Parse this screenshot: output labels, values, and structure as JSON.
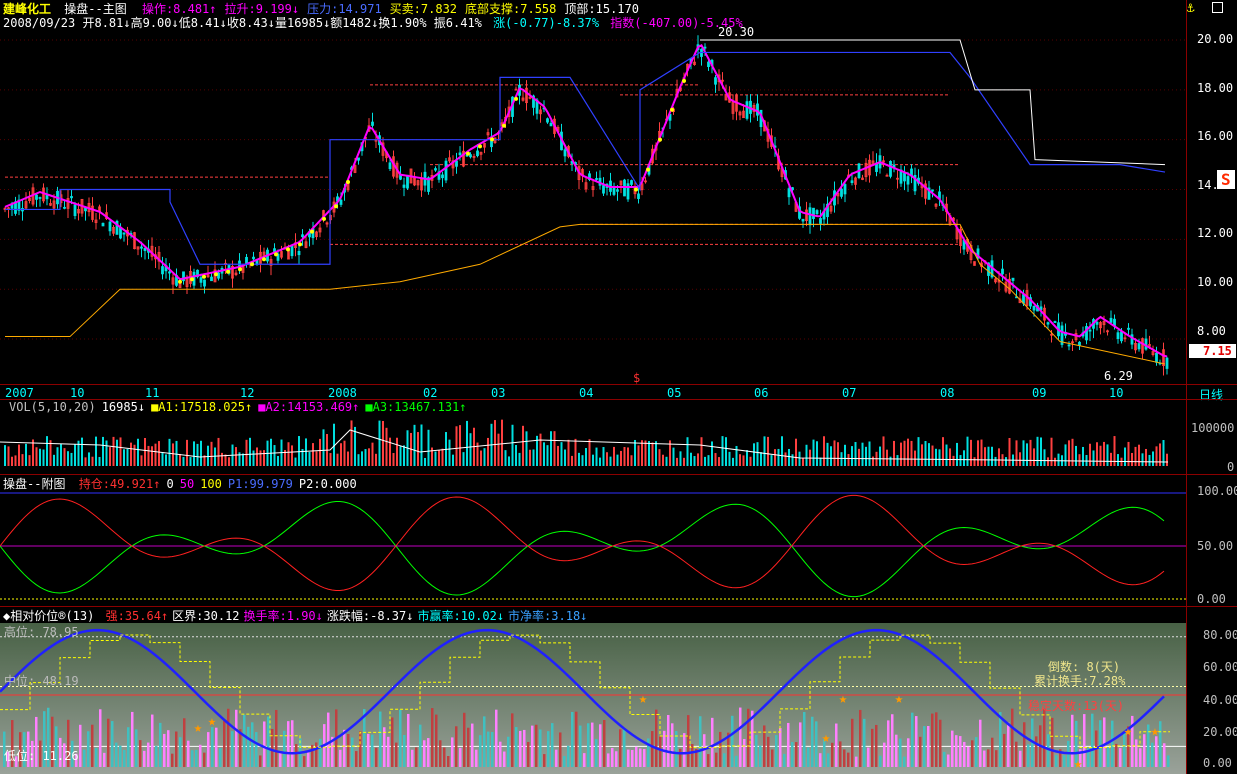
{
  "header": {
    "stock_name": "建峰化工",
    "main_title": "操盘--主图",
    "indicators": [
      {
        "label": "操作:8.481",
        "arrow": "↑",
        "color": "#ff00ff"
      },
      {
        "label": "拉升:9.199",
        "arrow": "↓",
        "color": "#ff00ff"
      },
      {
        "label": "压力:14.971",
        "arrow": "",
        "color": "#4a6cff"
      },
      {
        "label": "买卖:7.832",
        "arrow": "",
        "color": "#ffff00"
      },
      {
        "label": "底部支撑:7.558",
        "arrow": "",
        "color": "#ffff00"
      },
      {
        "label": "顶部:15.170",
        "arrow": "",
        "color": "#ffffff"
      }
    ],
    "quote_line": "2008/09/23  开8.81↓高9.00↓低8.41↓收8.43↓量16985↓额1482↓换1.90%  振6.41%",
    "change_text": "涨(-0.77)-8.37%",
    "index_text": "指数(-407.00)-5.45%",
    "corner_icon": "anchor-icon"
  },
  "main_chart": {
    "high_marker": "20.30",
    "low_marker": "6.29",
    "current_price": "7.15",
    "y_ticks": [
      "20.00",
      "18.00",
      "16.00",
      "14.00",
      "12.00",
      "10.00",
      "8.00"
    ],
    "period": "日线",
    "logo_text": "S"
  },
  "time_axis": {
    "labels": [
      "2007",
      "10",
      "11",
      "12",
      "2008",
      "02",
      "03",
      "04",
      "05",
      "06",
      "07",
      "08",
      "09",
      "10"
    ],
    "marker": "$"
  },
  "volume": {
    "header": [
      {
        "text": "VOL(5,10,20)",
        "color": "#c0c0c0"
      },
      {
        "text": "16985↓",
        "color": "#ffffff"
      },
      {
        "text": "■A1:17518.025↑",
        "color": "#ffff00"
      },
      {
        "text": "■A2:14153.469↑",
        "color": "#ff00ff"
      },
      {
        "text": "■A3:13467.131↑",
        "color": "#00ff00"
      }
    ],
    "y_ticks": [
      "100000",
      "0"
    ]
  },
  "sub1": {
    "title": "操盘--附图",
    "items": [
      {
        "text": "持仓:49.921↑",
        "color": "#ff3030"
      },
      {
        "text": "0",
        "color": "#ffffff"
      },
      {
        "text": "50",
        "color": "#ff00ff"
      },
      {
        "text": "100",
        "color": "#ffff00"
      },
      {
        "text": "P1:99.979",
        "color": "#4a6cff"
      },
      {
        "text": "P2:0.000",
        "color": "#ffffff"
      }
    ],
    "y_ticks": [
      "100.00",
      "50.00",
      "0.00"
    ]
  },
  "sub2": {
    "title": "◆相对价位®(13)",
    "items": [
      {
        "text": "强:35.64↑",
        "color": "#ff3030"
      },
      {
        "text": "区界:30.12",
        "color": "#ffffff"
      },
      {
        "text": "换手率:1.90↓",
        "color": "#ff00ff"
      },
      {
        "text": "涨跌幅:-8.37↓",
        "color": "#ffffff"
      },
      {
        "text": "市赢率:10.02↓",
        "color": "#00ffff"
      },
      {
        "text": "市净率:3.18↓",
        "color": "#3aa0ff"
      }
    ],
    "high_label": "高位: 78.95",
    "mid_label": "中位: 48.19",
    "low_label": "低位: 11.26",
    "countdown": "倒数: 8(天)",
    "cumulative": "累计换手:7.28%",
    "stable_days": "稳定天数:13(天)",
    "y_ticks": [
      "80.00",
      "60.00",
      "40.00",
      "20.00",
      "0.00"
    ]
  },
  "colors": {
    "up": "#ff4040",
    "down": "#00e0e0",
    "panel_border": "#8b0000"
  }
}
